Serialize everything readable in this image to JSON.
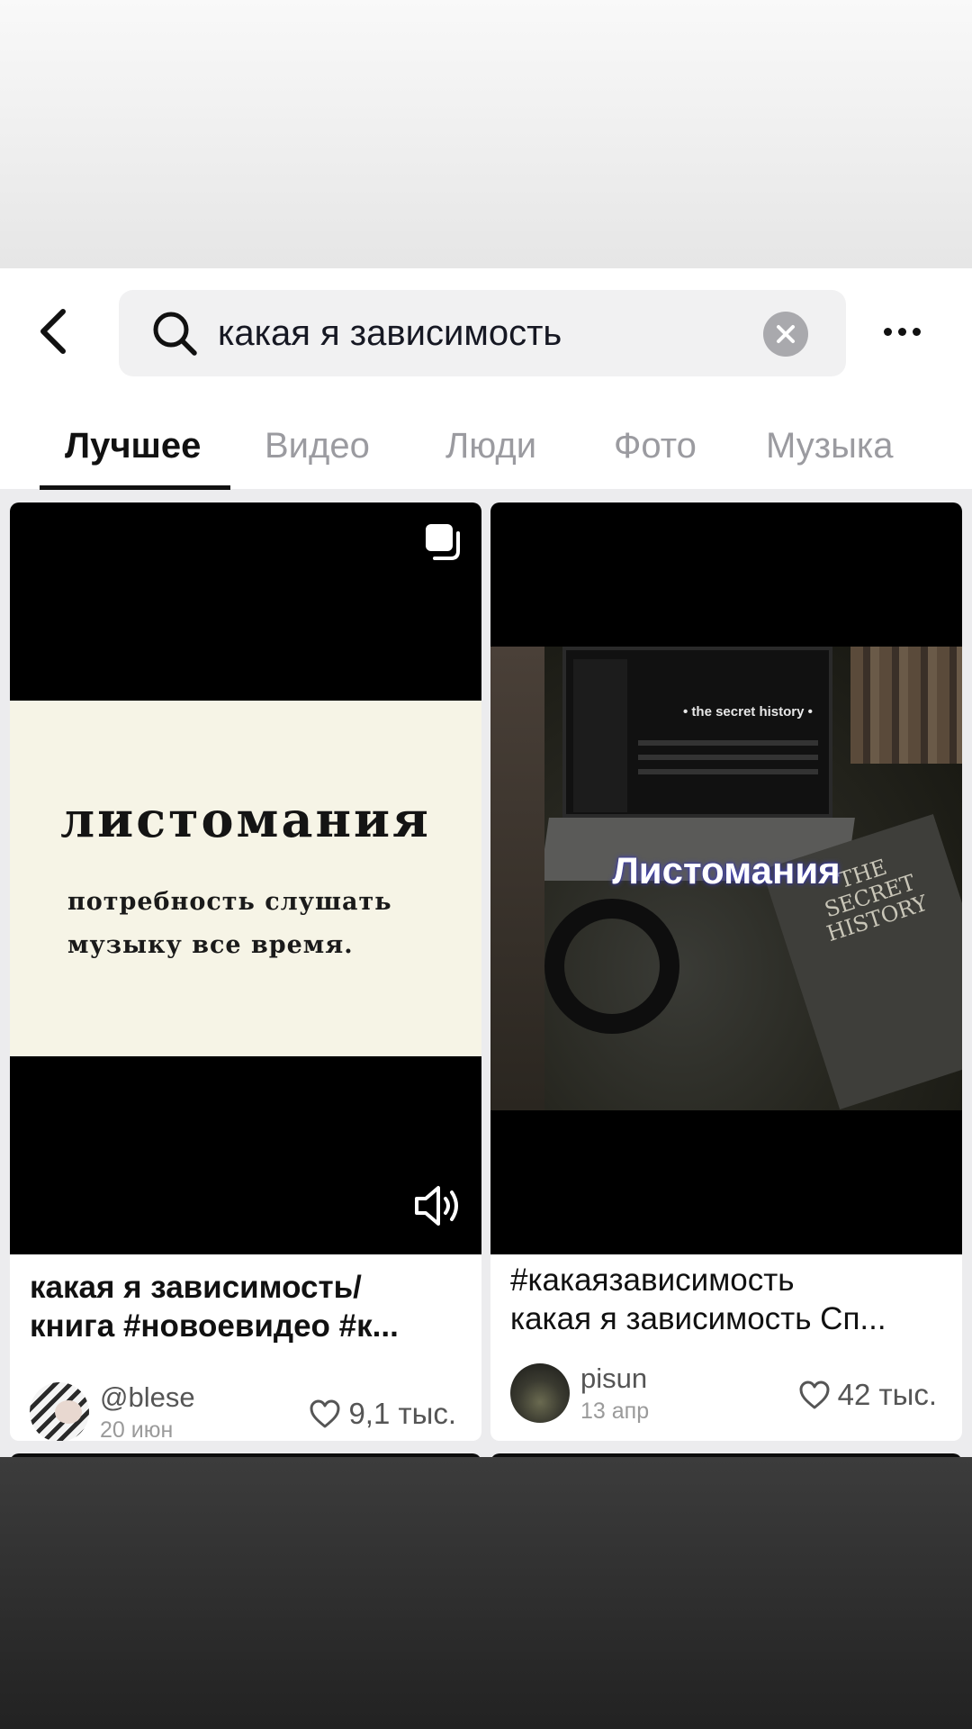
{
  "search": {
    "query": "какая я зависимость"
  },
  "tabs": [
    {
      "label": "Лучшее"
    },
    {
      "label": "Видео"
    },
    {
      "label": "Люди"
    },
    {
      "label": "Фото"
    },
    {
      "label": "Музыка"
    }
  ],
  "results": [
    {
      "thumbnail": {
        "word": "листомания",
        "definition_line1": "потребность слушать",
        "definition_line2": "музыку все время."
      },
      "title_line1": "какая я зависимость/",
      "title_line2": "книга  #новоевидео #к...",
      "author": "@blese",
      "date": "20 июн",
      "likes": "9,1 тыс."
    },
    {
      "thumbnail": {
        "caption": "Листомания",
        "screen_text": "• the secret history •",
        "book_text": "THE SECRET HISTORY"
      },
      "title_line1": "#какаязависимость",
      "title_line2": "какая я зависимость Сп...",
      "author": "pisun",
      "date": "13 апр",
      "likes": "42 тыс."
    }
  ]
}
